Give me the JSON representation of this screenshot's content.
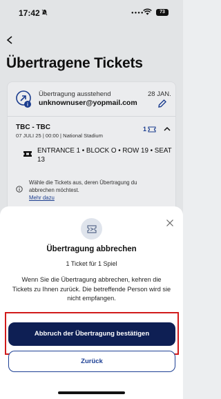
{
  "status_bar": {
    "time": "17:42",
    "battery": "73"
  },
  "page": {
    "title": "Übertragene Tickets"
  },
  "transfer": {
    "status": "Übertragung ausstehend",
    "date": "28 JAN.",
    "email": "unknownuser@yopmail.com"
  },
  "event": {
    "name": "TBC - TBC",
    "details": "07 JULI 25 | 00:00 | National Stadium",
    "ticket_count": "1",
    "seat": "ENTRANCE 1 • BLOCK O • ROW 19 • SEAT 13"
  },
  "info": {
    "text": "Wähle die Tickets aus, deren Übertragung du abbrechen möchtest.",
    "link": "Mehr dazu"
  },
  "sheet": {
    "title": "Übertragung abbrechen",
    "subtitle": "1 Ticket für 1 Spiel",
    "body": "Wenn Sie die Übertragung abbrechen, kehren die Tickets zu Ihnen zurück. Die betreffende Person wird sie nicht empfangen.",
    "confirm_label": "Abbruch der Übertragung bestätigen",
    "back_label": "Zurück"
  },
  "colors": {
    "primary": "#0e1f54",
    "accent": "#1c3f94",
    "highlight": "#d11a1a"
  }
}
